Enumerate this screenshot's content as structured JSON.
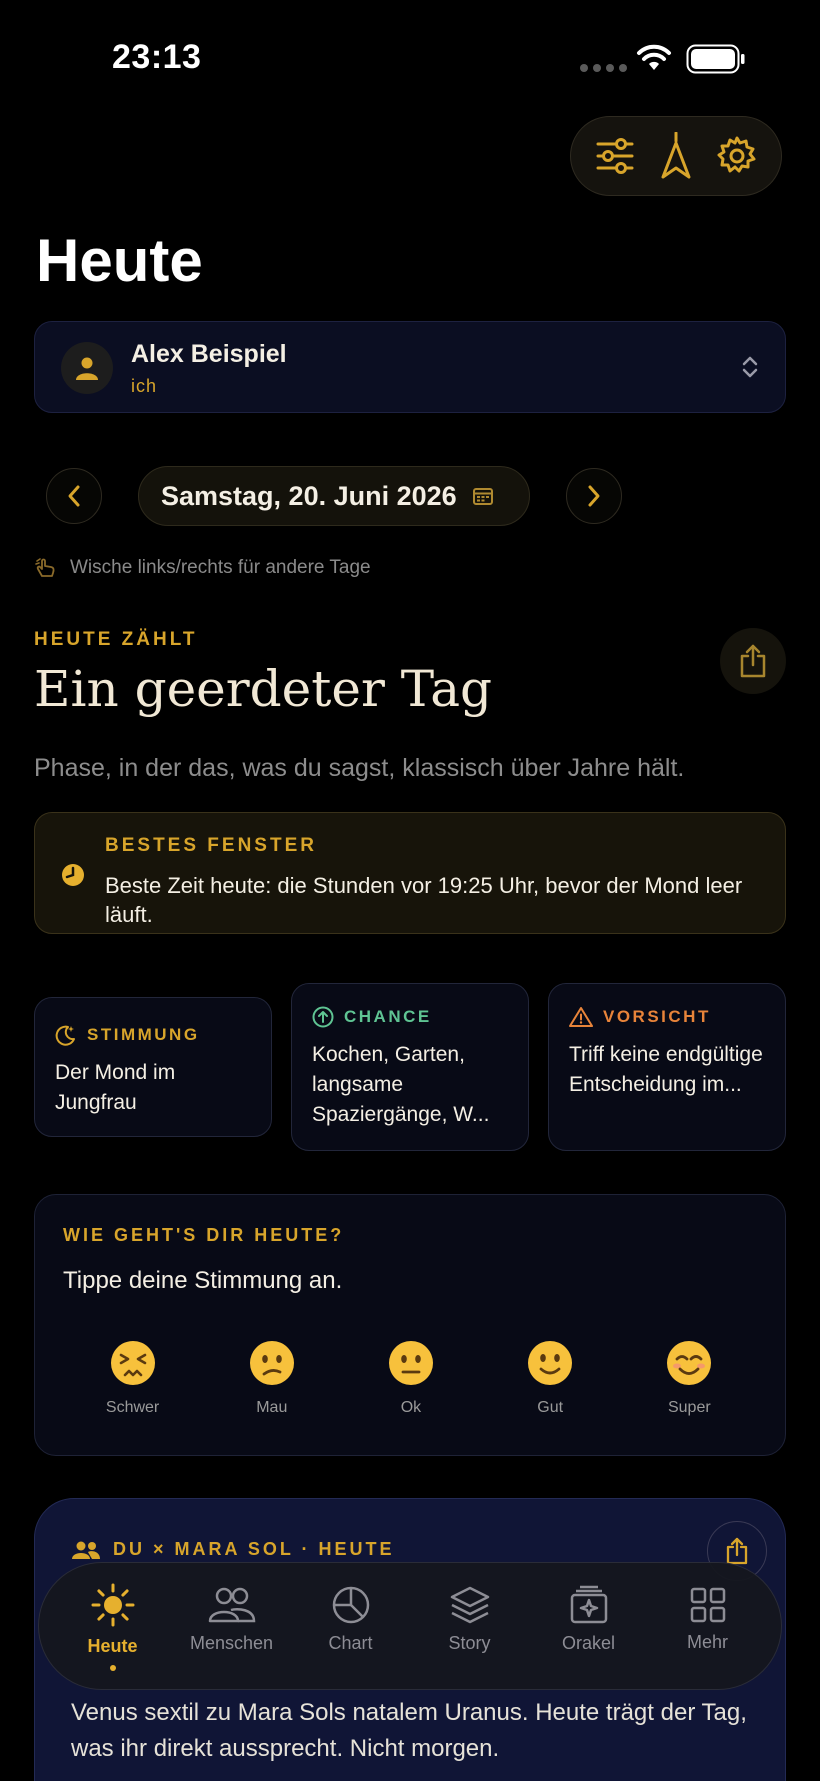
{
  "status": {
    "time": "23:13"
  },
  "header": {
    "title": "Heute"
  },
  "profile": {
    "name": "Alex Beispiel",
    "relation": "ich"
  },
  "date_nav": {
    "date": "Samstag, 20. Juni 2026",
    "swipe_hint": "Wische links/rechts für andere Tage"
  },
  "today": {
    "eyebrow": "HEUTE ZÄHLT",
    "headline": "Ein geerdeter Tag",
    "subtitle": "Phase, in der das, was du sagst, klassisch über Jahre hält."
  },
  "best_window": {
    "title": "BESTES FENSTER",
    "text": "Beste Zeit heute: die Stunden vor 19:25 Uhr, bevor der Mond leer läuft."
  },
  "cards": {
    "stimmung": {
      "title": "STIMMUNG",
      "text": "Der Mond im Jungfrau"
    },
    "chance": {
      "title": "CHANCE",
      "text": "Kochen, Garten, langsame Spaziergänge, W..."
    },
    "vorsicht": {
      "title": "VORSICHT",
      "text": "Triff keine endgültige Entscheidung im..."
    }
  },
  "mood": {
    "title": "WIE GEHT'S DIR HEUTE?",
    "prompt": "Tippe deine Stimmung an.",
    "options": [
      {
        "emoji": "😣",
        "label": "Schwer"
      },
      {
        "emoji": "😕",
        "label": "Mau"
      },
      {
        "emoji": "😐",
        "label": "Ok"
      },
      {
        "emoji": "🙂",
        "label": "Gut"
      },
      {
        "emoji": "😊",
        "label": "Super"
      }
    ]
  },
  "synastry": {
    "title": "DU × MARA SOL · HEUTE",
    "text": "Venus sextil zu Mara Sols natalem Uranus. Heute trägt der Tag, was ihr direkt aussprecht. Nicht morgen."
  },
  "tabs": [
    {
      "label": "Heute",
      "icon": "sun-icon",
      "active": true
    },
    {
      "label": "Menschen",
      "icon": "people-icon"
    },
    {
      "label": "Chart",
      "icon": "chart-icon"
    },
    {
      "label": "Story",
      "icon": "layers-icon"
    },
    {
      "label": "Orakel",
      "icon": "oracle-icon"
    },
    {
      "label": "Mehr",
      "icon": "grid-icon"
    }
  ],
  "colors": {
    "accent": "#D8A52B",
    "chance": "#5FC493",
    "caution": "#E8843A",
    "background": "#000000"
  }
}
